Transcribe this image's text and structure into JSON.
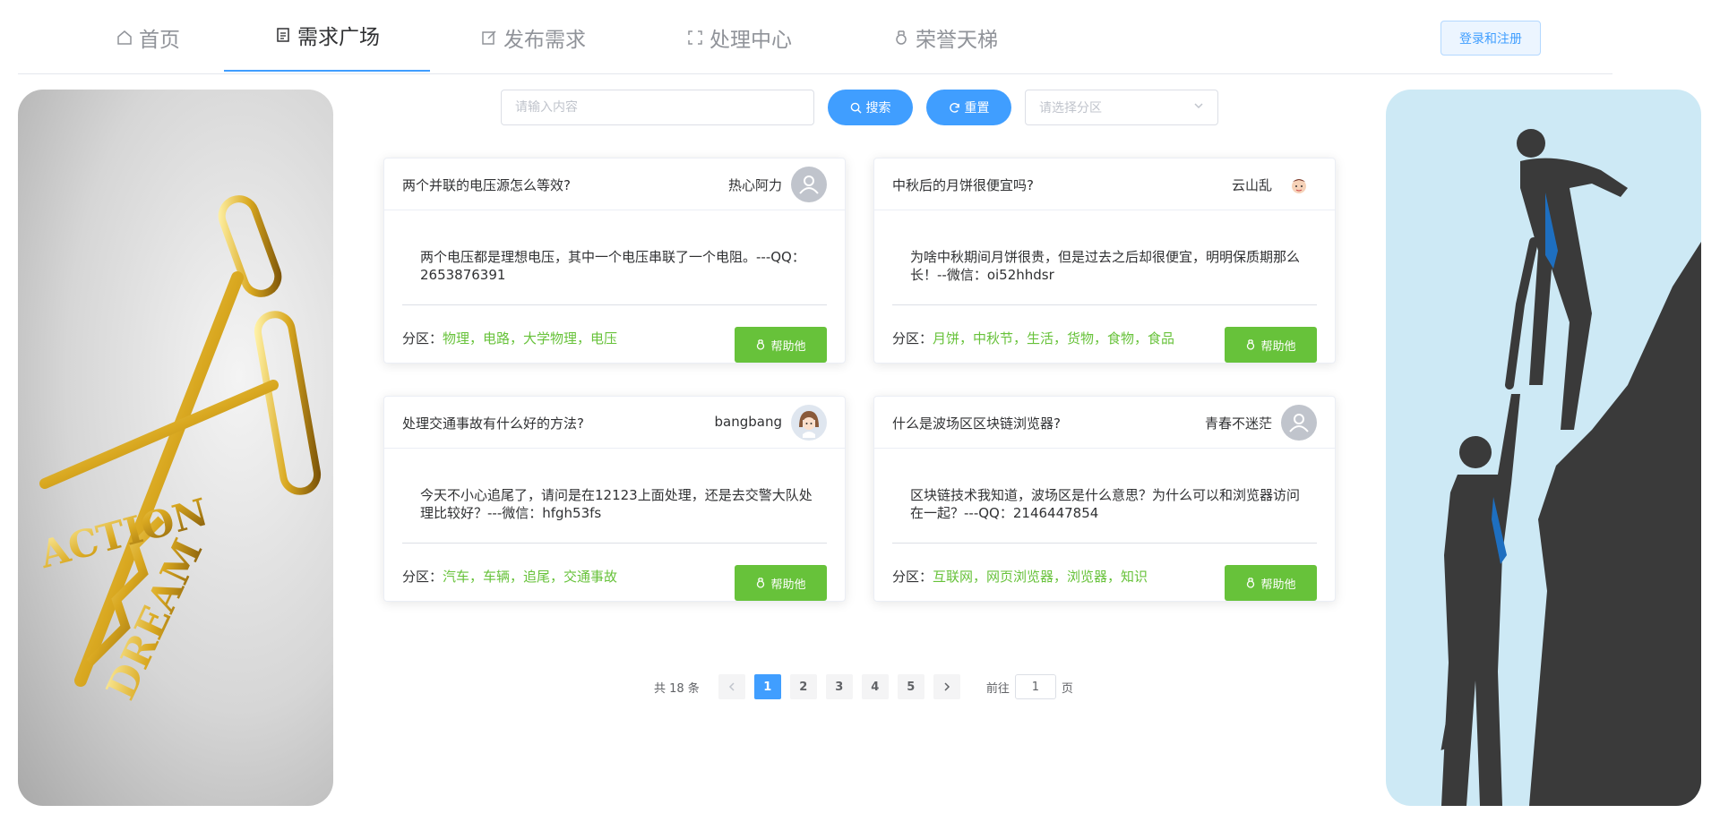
{
  "nav": {
    "items": [
      {
        "label": "首页",
        "icon": "home-icon"
      },
      {
        "label": "需求广场",
        "icon": "document-icon"
      },
      {
        "label": "发布需求",
        "icon": "edit-icon"
      },
      {
        "label": "处理中心",
        "icon": "fullscreen-icon"
      },
      {
        "label": "荣誉天梯",
        "icon": "medal-icon"
      }
    ],
    "active_index": 1,
    "login_label": "登录和注册"
  },
  "search": {
    "placeholder": "请输入内容",
    "search_label": "搜索",
    "reset_label": "重置",
    "select_placeholder": "请选择分区"
  },
  "side_images": {
    "left_text_1": "ACTION",
    "left_text_2": "DREAM"
  },
  "cards": [
    {
      "title": "两个并联的电压源怎么等效?",
      "user": "热心阿力",
      "avatar": "default-avatar",
      "body": "两个电压都是理想电压，其中一个电压串联了一个电阻。---QQ：2653876391",
      "tag_prefix": "分区：",
      "tags": "物理，电路，大学物理，电压",
      "help_label": "帮助他"
    },
    {
      "title": "中秋后的月饼很便宜吗?",
      "user": "云山乱",
      "avatar": "cartoon-boy-avatar",
      "body": "为啥中秋期间月饼很贵，但是过去之后却很便宜，明明保质期那么长！--微信：oi52hhdsr",
      "tag_prefix": "分区：",
      "tags": "月饼，中秋节，生活，货物，食物，食品",
      "help_label": "帮助他"
    },
    {
      "title": "处理交通事故有什么好的方法?",
      "user": "bangbang",
      "avatar": "cartoon-girl-avatar",
      "body": "今天不小心追尾了，请问是在12123上面处理，还是去交警大队处理比较好？---微信：hfgh53fs",
      "tag_prefix": "分区：",
      "tags": "汽车，车辆，追尾，交通事故",
      "help_label": "帮助他"
    },
    {
      "title": "什么是波场区区块链浏览器?",
      "user": "青春不迷茫",
      "avatar": "default-avatar",
      "body": "区块链技术我知道，波场区是什么意思？为什么可以和浏览器访问在一起？---QQ：2146447854",
      "tag_prefix": "分区：",
      "tags": "互联网，网页浏览器，浏览器，知识",
      "help_label": "帮助他"
    }
  ],
  "pagination": {
    "total_text": "共 18 条",
    "pages": [
      "1",
      "2",
      "3",
      "4",
      "5"
    ],
    "current": 1,
    "goto_prefix": "前往",
    "goto_value": "1",
    "goto_suffix": "页"
  },
  "colors": {
    "primary": "#409eff",
    "success": "#67c23a",
    "text": "#303133",
    "muted": "#909399"
  }
}
